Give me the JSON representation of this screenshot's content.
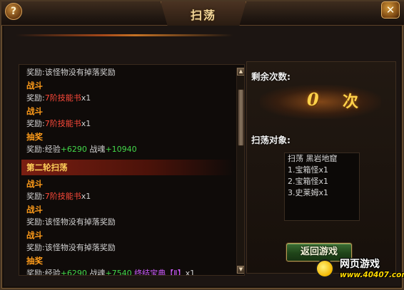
{
  "window": {
    "title": "扫荡",
    "help_label": "?",
    "close_label": "✕"
  },
  "log": {
    "first_round": [
      {
        "kind": "reward",
        "prefix": "奖励:",
        "text": "该怪物没有掉落奖励"
      },
      {
        "kind": "type",
        "text": "战斗"
      },
      {
        "kind": "reward",
        "prefix": "奖励:",
        "item": "7阶技能书",
        "qty": "x1"
      },
      {
        "kind": "type",
        "text": "战斗"
      },
      {
        "kind": "reward",
        "prefix": "奖励:",
        "item": "7阶技能书",
        "qty": "x1"
      },
      {
        "kind": "type",
        "text": "抽奖"
      },
      {
        "kind": "exp",
        "prefix": "奖励:",
        "exp_label": "经验",
        "exp_value": "+6290",
        "soul_label": "战魂",
        "soul_value": "+10940"
      }
    ],
    "second_round_title": "第二轮扫荡",
    "second_round": [
      {
        "kind": "type",
        "text": "战斗"
      },
      {
        "kind": "reward",
        "prefix": "奖励:",
        "item": "7阶技能书",
        "qty": "x1"
      },
      {
        "kind": "type",
        "text": "战斗"
      },
      {
        "kind": "reward",
        "prefix": "奖励:",
        "text": "该怪物没有掉落奖励"
      },
      {
        "kind": "type",
        "text": "战斗"
      },
      {
        "kind": "reward",
        "prefix": "奖励:",
        "text": "该怪物没有掉落奖励"
      },
      {
        "kind": "type",
        "text": "抽奖"
      },
      {
        "kind": "exp",
        "prefix": "奖励:",
        "exp_label": "经验",
        "exp_value": "+6290",
        "soul_label": "战魂",
        "soul_value": "+7540",
        "bonus_item": "终结宝典【Ⅱ】",
        "bonus_qty": "x1"
      }
    ]
  },
  "right": {
    "remaining_label": "剩余次数:",
    "remaining_count": "0",
    "remaining_unit": "次",
    "target_label": "扫荡对象:",
    "target_lines": [
      "扫荡 黑岩地窟",
      "1.宝箱怪x1",
      "2.宝箱怪x1",
      "3.史莱姆x1"
    ],
    "return_button": "返回游戏"
  },
  "watermark": {
    "title": "网页游戏",
    "url": "www.40407.com"
  },
  "colors": {
    "type_orange": "#ff9c1a",
    "item_red": "#ff4a3a",
    "value_green": "#43d84a",
    "bonus_purple": "#d05cff",
    "count_gold": "#ffd24a"
  }
}
